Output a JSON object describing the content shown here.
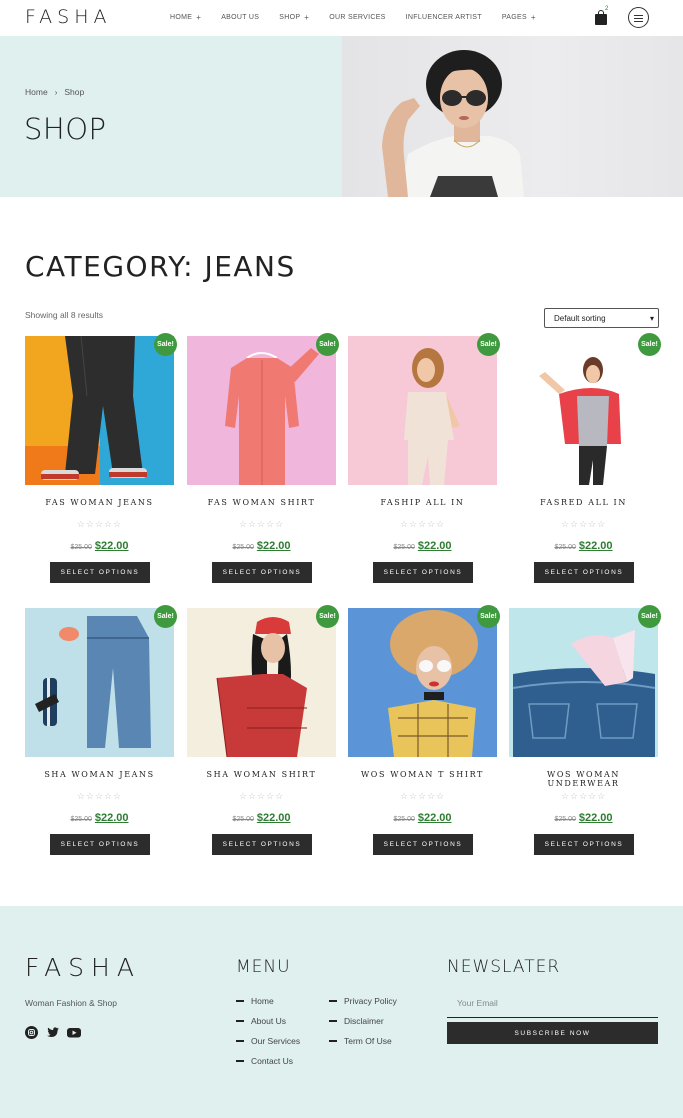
{
  "header": {
    "logo": "FASHA",
    "nav": [
      {
        "label": "HOME",
        "plus": "+"
      },
      {
        "label": "ABOUT US",
        "plus": ""
      },
      {
        "label": "SHOP",
        "plus": "+"
      },
      {
        "label": "OUR SERVICES",
        "plus": ""
      },
      {
        "label": "INFLUENCER ARTIST",
        "plus": ""
      },
      {
        "label": "PAGES",
        "plus": "+"
      }
    ],
    "cart_count": "2"
  },
  "hero": {
    "breadcrumb_home": "Home",
    "breadcrumb_sep": "›",
    "breadcrumb_current": "Shop",
    "title": "SHOP"
  },
  "category": {
    "title": "CATEGORY: JEANS",
    "result_count": "Showing all 8 results",
    "sort_selected": "Default sorting"
  },
  "products": [
    {
      "name": "FAS WOMAN JEANS",
      "old_price": "$25.00",
      "price": "$22.00",
      "badge": "Sale!",
      "stars": "☆☆☆☆☆",
      "button": "SELECT OPTIONS"
    },
    {
      "name": "FAS WOMAN SHIRT",
      "old_price": "$25.00",
      "price": "$22.00",
      "badge": "Sale!",
      "stars": "☆☆☆☆☆",
      "button": "SELECT OPTIONS"
    },
    {
      "name": "FASHIP ALL IN",
      "old_price": "$25.00",
      "price": "$22.00",
      "badge": "Sale!",
      "stars": "☆☆☆☆☆",
      "button": "SELECT OPTIONS"
    },
    {
      "name": "FASRED ALL IN",
      "old_price": "$25.00",
      "price": "$22.00",
      "badge": "Sale!",
      "stars": "☆☆☆☆☆",
      "button": "SELECT OPTIONS"
    },
    {
      "name": "SHA WOMAN JEANS",
      "old_price": "$25.00",
      "price": "$22.00",
      "badge": "Sale!",
      "stars": "☆☆☆☆☆",
      "button": "SELECT OPTIONS"
    },
    {
      "name": "SHA WOMAN SHIRT",
      "old_price": "$25.00",
      "price": "$22.00",
      "badge": "Sale!",
      "stars": "☆☆☆☆☆",
      "button": "SELECT OPTIONS"
    },
    {
      "name": "WOS WOMAN T SHIRT",
      "old_price": "$25.00",
      "price": "$22.00",
      "badge": "Sale!",
      "stars": "☆☆☆☆☆",
      "button": "SELECT OPTIONS"
    },
    {
      "name": "WOS WOMAN UNDERWEAR",
      "old_price": "$25.00",
      "price": "$22.00",
      "badge": "Sale!",
      "stars": "☆☆☆☆☆",
      "button": "SELECT OPTIONS"
    }
  ],
  "footer": {
    "logo": "FASHA",
    "tagline": "Woman Fashion & Shop",
    "social_icons": [
      "instagram-icon",
      "twitter-icon",
      "youtube-icon"
    ],
    "menu_heading": "MENU",
    "menu_col1": [
      "Home",
      "About Us",
      "Our Services",
      "Contact Us"
    ],
    "menu_col2": [
      "Privacy Policy",
      "Disclaimer",
      "Term Of Use"
    ],
    "newsletter_heading": "NEWSLATER",
    "email_placeholder": "Your Email",
    "subscribe_label": "SUBSCRIBE NOW"
  },
  "colors": {
    "accent_green": "#3f9a3f",
    "price_green": "#2e7d32",
    "mint_bg": "#dff0ef",
    "button_dark": "#2c2c2c"
  }
}
